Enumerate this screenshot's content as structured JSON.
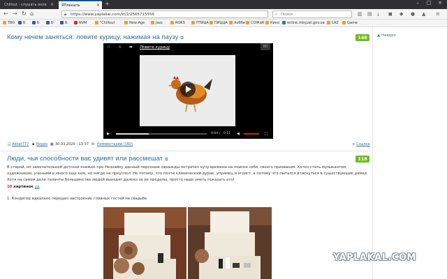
{
  "browser": {
    "tabs": [
      {
        "label": "Chillout - слушать онла"
      },
      {
        "label": "ЯПлакалъ"
      }
    ],
    "url": "https://www.yaplakal.com/st/2/2565715556",
    "search_placeholder": "Поиск",
    "bookmarks": [
      {
        "label": "TBO"
      },
      {
        "label": "Б"
      },
      {
        "label": "Б"
      },
      {
        "label": "Б"
      },
      {
        "label": "Б"
      },
      {
        "label": "NVM"
      },
      {
        "label": "\"Chillout"
      },
      {
        "label": "New Age"
      },
      {
        "label": "Jazz"
      },
      {
        "label": "ROKS"
      },
      {
        "label": "ПТИЦА"
      },
      {
        "label": "ПИЦЦА"
      },
      {
        "label": "Хобби"
      },
      {
        "label": "СОЖаК"
      },
      {
        "label": "Кино"
      },
      {
        "label": "online.minjust.gov.ua"
      },
      {
        "label": "LAZ"
      },
      {
        "label": "Game"
      }
    ]
  },
  "post1": {
    "title": "Кому нечем заняться: ловите курицу, нажимая на паузу",
    "score": "148",
    "video": {
      "title": "Ловите курицу",
      "time_current": "0:04",
      "time_total": "0:11",
      "progress": 0.36
    },
    "meta": {
      "author": "Adnat777",
      "category": "Видео",
      "date": "30.03.2020 - 13:37",
      "comments": "Комментарии (160)",
      "link": "Ссылка"
    }
  },
  "post2": {
    "title": "Люди, чьи способности вас удивят или рассмешат",
    "score": "118",
    "body": "В старой, но замечательной детской книжке про Незнайку данный персонаж однажды потратил кучу времени на поиски себя, своего призвания. Хотел стать музыкантом, художником, учеными и много еще кем, но нигде не преуспел. Не потому, что почти клинический дурак, упрямец и эгоист, а потому что пытался втиснуться в существующие рамки. Хотя на самом деле таланты большинства людей выходят далеко за их пределы, просто надо уметь показать его!",
    "count_num": "10",
    "count_word": "картинок",
    "count_link": "уд",
    "item1": "1. Кондитер идеально передал настроение главных гостей на свадьбе"
  },
  "sidebar": {
    "nav_link": "▲ Наверх"
  },
  "watermark": "YAPLAKAL.COM",
  "colors": {
    "title_blue": "#2d6fa3",
    "score_green": "#6bbf1f",
    "tab_bar": "#2f2f33"
  }
}
